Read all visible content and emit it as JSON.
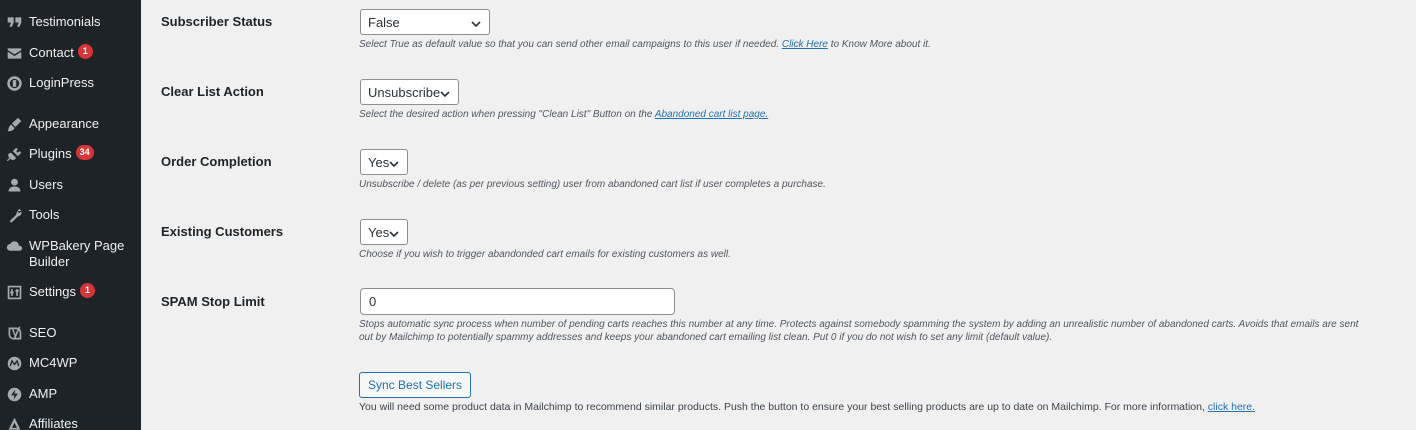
{
  "sidebar": {
    "items": [
      {
        "label": "Testimonials",
        "icon": "quote-icon",
        "badge": null
      },
      {
        "label": "Contact",
        "icon": "envelope-icon",
        "badge": "1"
      },
      {
        "label": "LoginPress",
        "icon": "loginpress-icon",
        "badge": null
      },
      {
        "label": "Appearance",
        "icon": "paintbrush-icon",
        "badge": null
      },
      {
        "label": "Plugins",
        "icon": "plug-icon",
        "badge": "34"
      },
      {
        "label": "Users",
        "icon": "user-icon",
        "badge": null
      },
      {
        "label": "Tools",
        "icon": "wrench-icon",
        "badge": null
      },
      {
        "label": "WPBakery Page",
        "label2": "Builder",
        "icon": "cloud-icon",
        "badge": null
      },
      {
        "label": "Settings",
        "icon": "sliders-icon",
        "badge": "1"
      },
      {
        "label": "SEO",
        "icon": "yoast-icon",
        "badge": null
      },
      {
        "label": "MC4WP",
        "icon": "mc4wp-icon",
        "badge": null
      },
      {
        "label": "AMP",
        "icon": "amp-icon",
        "badge": null
      },
      {
        "label": "Affiliates",
        "icon": "affiliates-icon",
        "badge": null
      }
    ]
  },
  "settings": {
    "subscriber_status": {
      "label": "Subscriber Status",
      "value": "False",
      "desc_before": "Select True as default value so that you can send other email campaigns to this user if needed. ",
      "link": "Click Here",
      "desc_after": " to Know More about it."
    },
    "clear_list_action": {
      "label": "Clear List Action",
      "value": "Unsubscribe",
      "desc_before": "Select the desired action when pressing \"Clean List\" Button on the ",
      "link": "Abandoned cart list page."
    },
    "order_completion": {
      "label": "Order Completion",
      "value": "Yes",
      "desc": "Unsubscribe / delete (as per previous setting) user from abandoned cart list if user completes a purchase."
    },
    "existing_customers": {
      "label": "Existing Customers",
      "value": "Yes",
      "desc": "Choose if you wish to trigger abandonded cart emails for existing customers as well."
    },
    "spam_stop_limit": {
      "label": "SPAM Stop Limit",
      "value": "0",
      "desc_line1": "Stops automatic sync process when number of pending carts reaches this number at any time. Protects against somebody spamming the system by adding an unrealistic number of abandoned carts. Avoids that emails are sent",
      "desc_line2": "out by Mailchimp to potentially spammy addresses and keeps your abandoned cart emailing list clean. Put 0 if you do not wish to set any limit (default value)."
    },
    "sync_best_sellers": {
      "button": "Sync Best Sellers",
      "note_before": "You will need some product data in Mailchimp to recommend similar products. Push the button to ensure your best selling products are up to date on Mailchimp. For more information, ",
      "link": "click here."
    }
  },
  "colors": {
    "sidebar_bg": "#1d2327",
    "badge": "#d63638",
    "link": "#2271b1",
    "page_bg": "#f0f0f1"
  }
}
